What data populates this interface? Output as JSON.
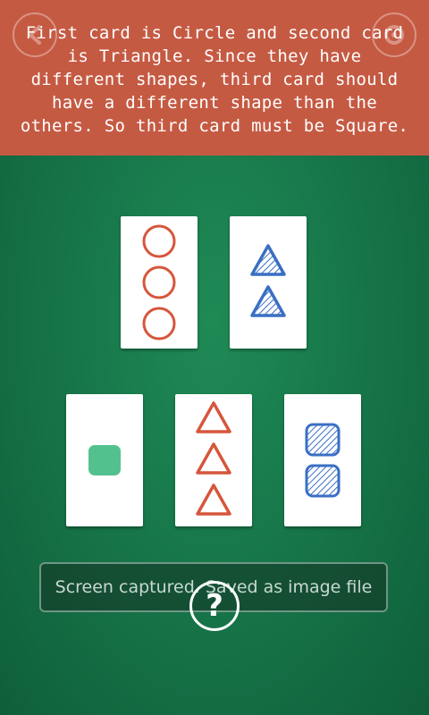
{
  "hint": {
    "text": "First card is Circle and second card is Triangle. Since they have different shapes, third card should have a different shape than the others. So third card must be Square."
  },
  "header": {
    "back_icon": "back-arrow-icon",
    "settings_icon": "gear-icon"
  },
  "colors": {
    "banner": "#c55a43",
    "felt": "#17774a",
    "red": "#d6563b",
    "blue": "#3a6fc4",
    "green": "#52c18e"
  },
  "reference_cards": [
    {
      "shape": "circle",
      "count": 3,
      "color": "red",
      "fill": "empty"
    },
    {
      "shape": "triangle",
      "count": 2,
      "color": "blue",
      "fill": "striped"
    }
  ],
  "choice_cards": [
    {
      "shape": "square",
      "count": 1,
      "color": "green",
      "fill": "solid"
    },
    {
      "shape": "triangle",
      "count": 3,
      "color": "red",
      "fill": "empty"
    },
    {
      "shape": "square",
      "count": 2,
      "color": "blue",
      "fill": "striped"
    }
  ],
  "toast": {
    "text": "Screen captured. Saved as image file"
  },
  "help": {
    "label": "?"
  }
}
